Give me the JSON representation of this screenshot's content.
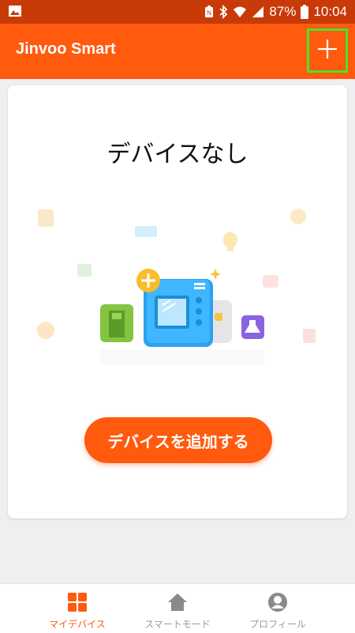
{
  "status_bar": {
    "battery": "87%",
    "time": "10:04"
  },
  "app_bar": {
    "title": "Jinvoo Smart",
    "add_icon": "plus-icon"
  },
  "main": {
    "empty_title": "デバイスなし",
    "add_device_button": "デバイスを追加する"
  },
  "bottom_nav": {
    "items": [
      {
        "label": "マイデバイス",
        "icon": "grid-icon",
        "active": true
      },
      {
        "label": "スマートモード",
        "icon": "home-icon",
        "active": false
      },
      {
        "label": "プロフィール",
        "icon": "person-icon",
        "active": false
      }
    ]
  },
  "colors": {
    "accent": "#ff5a0e",
    "status_bar": "#c83a08",
    "highlight": "#4ee12a"
  }
}
